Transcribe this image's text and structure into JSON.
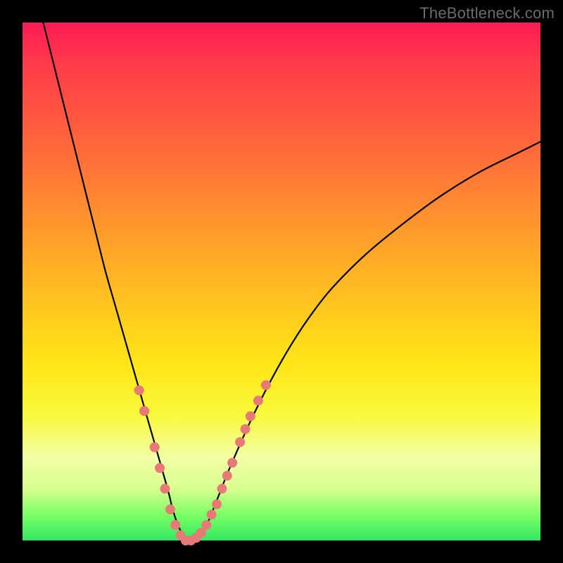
{
  "watermark": "TheBottleneck.com",
  "chart_data": {
    "type": "line",
    "title": "",
    "xlabel": "",
    "ylabel": "",
    "xlim": [
      0,
      100
    ],
    "ylim": [
      0,
      100
    ],
    "grid": false,
    "legend": false,
    "background": "heatmap-gradient",
    "series": [
      {
        "name": "bottleneck-curve",
        "color": "#000000",
        "x": [
          4,
          6,
          8,
          10,
          12,
          14,
          16,
          18,
          20,
          22,
          24,
          26,
          28,
          29,
          30,
          31,
          32,
          33,
          34,
          35,
          36,
          38,
          40,
          44,
          48,
          52,
          56,
          60,
          66,
          72,
          80,
          88,
          96,
          100
        ],
        "y": [
          100,
          92,
          84,
          76,
          68,
          60,
          52,
          45,
          38,
          31,
          24,
          17,
          10,
          6,
          3,
          1,
          0,
          0,
          1,
          2,
          4,
          9,
          14,
          23,
          31,
          38,
          44,
          49,
          55,
          60,
          66,
          71,
          75,
          77
        ]
      }
    ],
    "markers": {
      "name": "highlight-dots",
      "color": "#e77a77",
      "radius_px": 7,
      "points": [
        {
          "x": 22.5,
          "y": 29
        },
        {
          "x": 23.5,
          "y": 25
        },
        {
          "x": 25.5,
          "y": 18
        },
        {
          "x": 26.5,
          "y": 14
        },
        {
          "x": 27.5,
          "y": 10
        },
        {
          "x": 28.5,
          "y": 6
        },
        {
          "x": 29.5,
          "y": 3
        },
        {
          "x": 30.5,
          "y": 1
        },
        {
          "x": 31.5,
          "y": 0
        },
        {
          "x": 32.5,
          "y": 0
        },
        {
          "x": 33.5,
          "y": 0.5
        },
        {
          "x": 34.5,
          "y": 1.5
        },
        {
          "x": 35.5,
          "y": 3
        },
        {
          "x": 36.5,
          "y": 5
        },
        {
          "x": 37.5,
          "y": 7
        },
        {
          "x": 38.5,
          "y": 10
        },
        {
          "x": 39.5,
          "y": 12.5
        },
        {
          "x": 40.5,
          "y": 15
        },
        {
          "x": 42.0,
          "y": 19
        },
        {
          "x": 43.0,
          "y": 21.5
        },
        {
          "x": 44.0,
          "y": 24
        },
        {
          "x": 45.5,
          "y": 27
        },
        {
          "x": 47.0,
          "y": 30
        }
      ]
    }
  }
}
